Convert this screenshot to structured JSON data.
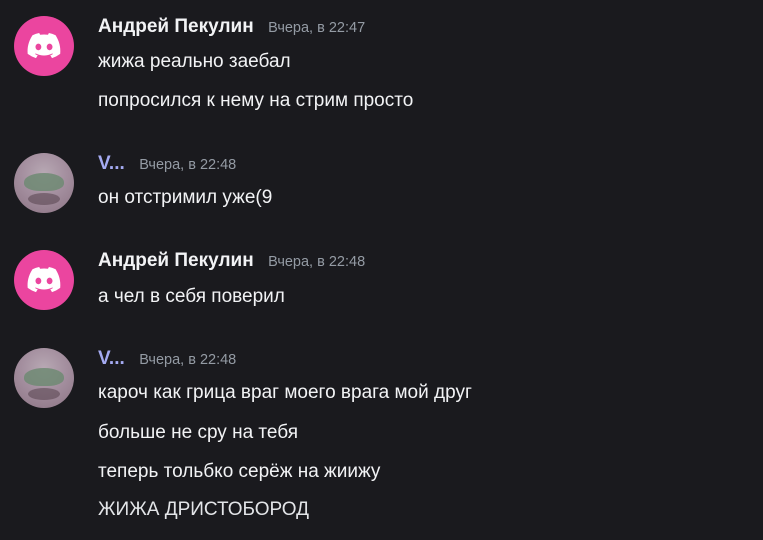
{
  "messages": [
    {
      "author": "Андрей Пекулин",
      "time": "Вчера, в 22:47",
      "avatar_icon": "discord-icon",
      "lines": [
        "жижа реально заебал",
        "попросился к нему на стрим просто"
      ]
    },
    {
      "author": "V...",
      "time": "Вчера, в 22:48",
      "avatar_icon": "photo-avatar",
      "lines": [
        "он отстримил уже(9"
      ]
    },
    {
      "author": "Андрей Пекулин",
      "time": "Вчера, в 22:48",
      "avatar_icon": "discord-icon",
      "lines": [
        "а чел в себя поверил"
      ]
    },
    {
      "author": "V...",
      "time": "Вчера, в 22:48",
      "avatar_icon": "photo-avatar",
      "lines": [
        "кароч как грица враг моего врага мой друг",
        "больше не сру на тебя",
        "теперь тольбко серёж на жиижу",
        "ЖИЖА ДРИСТОБОРОД"
      ]
    }
  ],
  "colors": {
    "background": "#1a1a1e",
    "discord_avatar": "#eb459f",
    "username": "#f2f3f5",
    "username_short": "#a5abf2",
    "timestamp": "#949ba4"
  }
}
